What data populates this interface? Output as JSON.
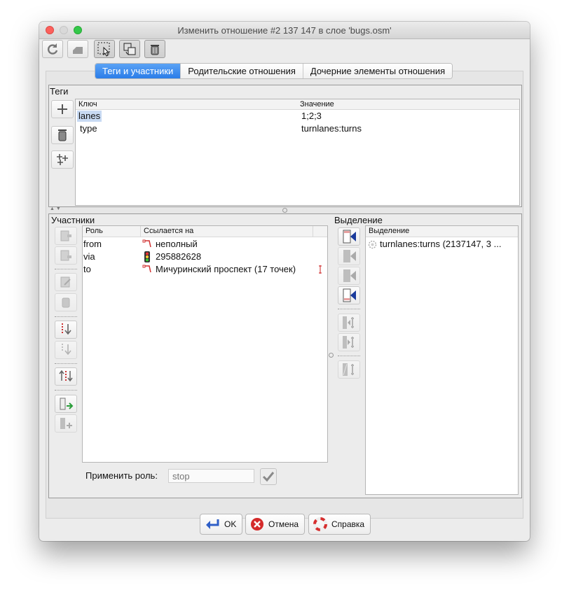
{
  "window": {
    "title": "Изменить отношение #2 137 147 в слое 'bugs.osm'"
  },
  "toolbar": {
    "buttons": [
      "refresh-icon",
      "apply-icon",
      "select-icon",
      "zoom-icon",
      "delete-icon"
    ]
  },
  "tabs": [
    {
      "label": "Теги и участники",
      "active": true
    },
    {
      "label": "Родительские отношения",
      "active": false
    },
    {
      "label": "Дочерние элементы отношения",
      "active": false
    }
  ],
  "tags": {
    "title": "Теги",
    "col_key": "Ключ",
    "col_value": "Значение",
    "rows": [
      {
        "key": "lanes",
        "value": "1;2;3"
      },
      {
        "key": "type",
        "value": "turnlanes:turns"
      }
    ]
  },
  "members": {
    "title": "Участники",
    "col_role": "Роль",
    "col_ref": "Ссылается на",
    "rows": [
      {
        "role": "from",
        "ref": "неполный",
        "icon": "way-icon"
      },
      {
        "role": "via",
        "ref": "295882628",
        "icon": "traffic-light-icon"
      },
      {
        "role": "to",
        "ref": "Мичуринский проспект (17 точек)",
        "icon": "way-icon"
      }
    ],
    "apply_role_label": "Применить роль:",
    "apply_role_placeholder": "stop"
  },
  "selection": {
    "title": "Выделение",
    "col": "Выделение",
    "rows": [
      {
        "label": "turnlanes:turns (2137147, 3 ...",
        "icon": "relation-icon"
      }
    ]
  },
  "buttons": {
    "ok": "OK",
    "cancel": "Отмена",
    "help": "Справка"
  },
  "colors": {
    "accent": "#2b7de8",
    "selection_highlight": "#c8daf3"
  }
}
